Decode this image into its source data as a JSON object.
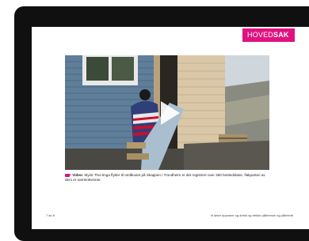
{
  "section_tag": {
    "part1": "HOVED",
    "part2": "SAK"
  },
  "video": {
    "caption_label": "Video:",
    "caption_text": "Myint Thoi tinga flytter til omåkuset på Skappen i Trondheim er det registrert over 350 bostedsløse, flakparten av dem er narrninkvinner."
  },
  "footer": {
    "page": "7 av 8",
    "tagline": "Vi løser oppnave og drekk og trekke påleresse og pålmedé"
  },
  "colors": {
    "accent": "#e0127f"
  },
  "icons": {
    "play": "play-icon",
    "video": "video-camera-icon"
  }
}
